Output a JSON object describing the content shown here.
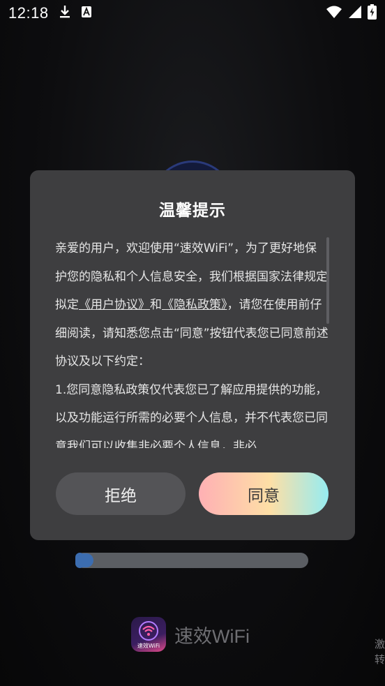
{
  "status_bar": {
    "time": "12:18",
    "icons": [
      "download-icon",
      "font-a-icon",
      "wifi-icon",
      "signal-icon",
      "battery-charging-icon"
    ]
  },
  "dialog": {
    "title": "温馨提示",
    "paragraphs": [
      {
        "before": "亲爱的用户，欢迎使用“速效WiFi”，为了更好地保护您的隐私和个人信息安全，我们根据国家法律规定拟定",
        "link1": "《用户协议》",
        "middle": "和",
        "link2": "《隐私政策》",
        "after": "，请您在使用前仔细阅读，请知悉您点击“同意”按钮代表您已同意前述协议及以下约定："
      }
    ],
    "clause_1": "1.您同意隐私政策仅代表您已了解应用提供的功能，以及功能运行所需的必要个人信息，并不代表您已同意我们可以收集非必要个人信息，非必",
    "reject_label": "拒绝",
    "agree_label": "同意"
  },
  "background": {
    "progress": 0.04,
    "brand_name": "速效WiFi",
    "logo_text": "速效WiFi",
    "side_text": "激\n转"
  },
  "colors": {
    "dialog_bg": "#3e3e40",
    "reject_bg": "#545457",
    "agree_gradient": [
      "#ffb0b4",
      "#fddfa6",
      "#96ecf1"
    ]
  }
}
